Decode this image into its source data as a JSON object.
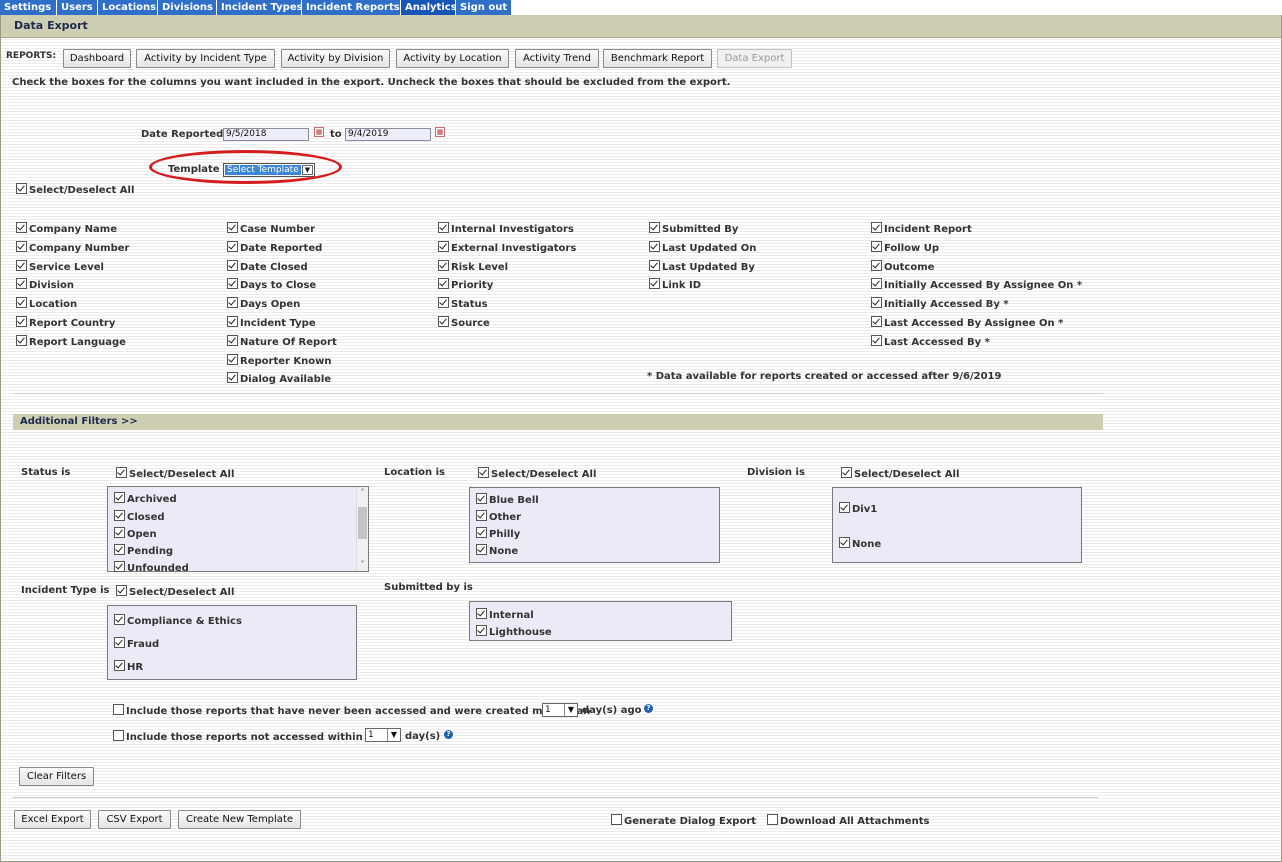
{
  "nav": {
    "tabs": [
      {
        "label": "Settings"
      },
      {
        "label": "Users"
      },
      {
        "label": "Locations"
      },
      {
        "label": "Divisions"
      },
      {
        "label": "Incident Types"
      },
      {
        "label": "Incident Reports"
      },
      {
        "label": "Analytics",
        "active": true
      },
      {
        "label": "Sign out"
      }
    ]
  },
  "page": {
    "title": "Data Export",
    "reports_label": "REPORTS:",
    "report_buttons": [
      {
        "label": "Dashboard"
      },
      {
        "label": "Activity by Incident Type"
      },
      {
        "label": "Activity by Division"
      },
      {
        "label": "Activity by Location"
      },
      {
        "label": "Activity Trend"
      },
      {
        "label": "Benchmark Report"
      },
      {
        "label": "Data Export",
        "disabled": true
      }
    ],
    "instructions": "Check the boxes for the columns you want included in the export. Uncheck the boxes that should be excluded from the export."
  },
  "date": {
    "label": "Date Reported",
    "from": "9/5/2018",
    "to_label": "to",
    "to": "9/4/2019"
  },
  "template": {
    "label": "Template",
    "value": "Select Template"
  },
  "columns": {
    "select_all": "Select/Deselect All",
    "col1": [
      "Company Name",
      "Company Number",
      "Service Level",
      "Division",
      "Location",
      "Report Country",
      "Report Language"
    ],
    "col2": [
      "Case Number",
      "Date Reported",
      "Date Closed",
      "Days to Close",
      "Days Open",
      "Incident Type",
      "Nature Of Report",
      "Reporter Known",
      "Dialog Available"
    ],
    "col3": [
      "Internal Investigators",
      "External Investigators",
      "Risk Level",
      "Priority",
      "Status",
      "Source"
    ],
    "col4": [
      "Submitted By",
      "Last Updated On",
      "Last Updated By",
      "Link ID"
    ],
    "col5": [
      "Incident Report",
      "Follow Up",
      "Outcome",
      "Initially Accessed By Assignee On *",
      "Initially Accessed By *",
      "Last Accessed By Assignee On *",
      "Last Accessed By *"
    ],
    "footnote": "* Data available for reports created or accessed after 9/6/2019"
  },
  "filters": {
    "header": "Additional Filters >>",
    "select_all": "Select/Deselect All",
    "status": {
      "label": "Status is",
      "items": [
        "Archived",
        "Closed",
        "Open",
        "Pending",
        "Unfounded"
      ]
    },
    "location": {
      "label": "Location is",
      "items": [
        "Blue Bell",
        "Other",
        "Philly",
        "None"
      ]
    },
    "division": {
      "label": "Division is",
      "items": [
        "Div1",
        "None"
      ]
    },
    "incident_type": {
      "label": "Incident Type is",
      "items": [
        "Compliance & Ethics",
        "Fraud",
        "HR"
      ]
    },
    "submitted_by": {
      "label": "Submitted by is",
      "items": [
        "Internal",
        "Lighthouse"
      ]
    },
    "never_accessed": {
      "text": "Include those reports that have never been accessed and were created more than",
      "value": "1",
      "suffix": "day(s) ago"
    },
    "not_accessed": {
      "text": "Include those reports not accessed within past",
      "value": "1",
      "suffix": "day(s)"
    },
    "clear_button": "Clear Filters"
  },
  "footer": {
    "excel_button": "Excel Export",
    "csv_button": "CSV Export",
    "template_button": "Create New Template",
    "dialog_export": "Generate Dialog Export",
    "download_attachments": "Download All Attachments"
  }
}
